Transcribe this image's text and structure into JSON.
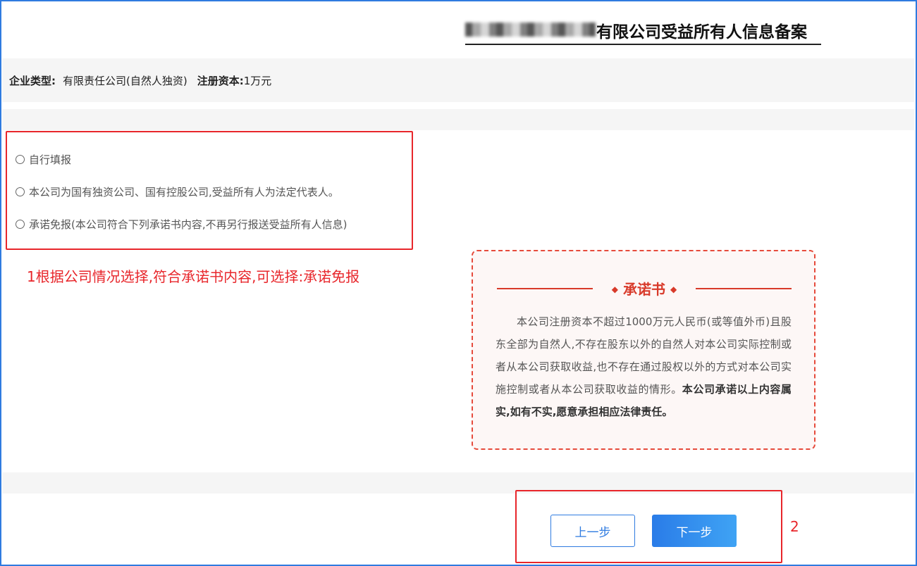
{
  "page": {
    "title_suffix": "有限公司受益所有人信息备案"
  },
  "company_info": {
    "type_label": "企业类型:",
    "type_value": "有限责任公司(自然人独资)",
    "capital_label": "注册资本:",
    "capital_value": "1万元"
  },
  "options": [
    {
      "label": "自行填报"
    },
    {
      "label": "本公司为国有独资公司、国有控股公司,受益所有人为法定代表人。"
    },
    {
      "label": "承诺免报(本公司符合下列承诺书内容,不再另行报送受益所有人信息)"
    }
  ],
  "annotation_1": "1根据公司情况选择,符合承诺书内容,可选择:承诺免报",
  "pledge": {
    "title": "承诺书",
    "body": "本公司注册资本不超过1000万元人民币(或等值外币)且股东全部为自然人,不存在股东以外的自然人对本公司实际控制或者从本公司获取收益,也不存在通过股权以外的方式对本公司实施控制或者从本公司获取收益的情形。",
    "body_bold": "本公司承诺以上内容属实,如有不实,愿意承担相应法律责任。"
  },
  "buttons": {
    "prev": "上一步",
    "next": "下一步"
  },
  "annotation_2": "2",
  "colors": {
    "frame": "#2f7be0",
    "annotation_red": "#e8262b",
    "pledge_red": "#d83a2a",
    "primary_blue": "#2a7ce8"
  }
}
